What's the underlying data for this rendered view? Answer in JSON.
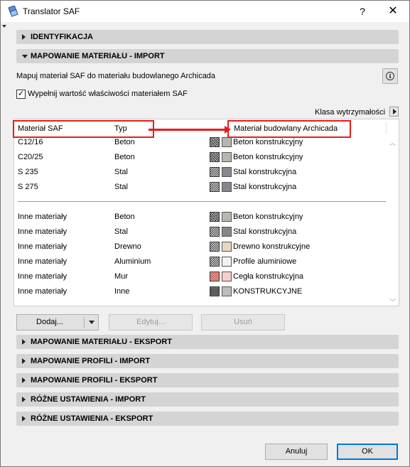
{
  "window": {
    "title": "Translator SAF",
    "help": "?",
    "close": "✕"
  },
  "sections": {
    "identyfikacja": "IDENTYFIKACJA",
    "mapowanie_import": "MAPOWANIE MATERIAŁU - IMPORT",
    "mapowanie_eksport": "MAPOWANIE MATERIAŁU - EKSPORT",
    "profile_import": "MAPOWANIE PROFILI - IMPORT",
    "profile_eksport": "MAPOWANIE PROFILI - EKSPORT",
    "rozne_import": "RÓŻNE USTAWIENIA - IMPORT",
    "rozne_eksport": "RÓŻNE USTAWIENIA - EKSPORT"
  },
  "import_panel": {
    "description": "Mapuj materiał SAF do materiału budowlanego Archicada",
    "info_icon": "i",
    "checkbox_label": "Wypełnij wartość właściwości materiałem SAF",
    "checkbox_checked": true,
    "checkbox_mark": "✓",
    "klasa_label": "Klasa wytrzymałości"
  },
  "table": {
    "headers": {
      "saf": "Materiał SAF",
      "typ": "Typ",
      "archicad": "Materiał budowlany Archicada"
    },
    "rows": [
      {
        "saf": "C12/16",
        "typ": "Beton",
        "archicad": "Beton konstrukcyjny",
        "hatch": "cross",
        "color": "#b7b7b2"
      },
      {
        "saf": "C20/25",
        "typ": "Beton",
        "archicad": "Beton konstrukcyjny",
        "hatch": "cross",
        "color": "#b7b7b2"
      },
      {
        "saf": "S 235",
        "typ": "Stal",
        "archicad": "Stal konstrukcyjna",
        "hatch": "diag",
        "color": "#84878b"
      },
      {
        "saf": "S 275",
        "typ": "Stal",
        "archicad": "Stal konstrukcyjna",
        "hatch": "diag",
        "color": "#84878b"
      }
    ],
    "other_rows": [
      {
        "saf": "Inne materiały",
        "typ": "Beton",
        "archicad": "Beton konstrukcyjny",
        "hatch": "cross",
        "color": "#b7b7b2"
      },
      {
        "saf": "Inne materiały",
        "typ": "Stal",
        "archicad": "Stal konstrukcyjna",
        "hatch": "diag",
        "color": "#84878b"
      },
      {
        "saf": "Inne materiały",
        "typ": "Drewno",
        "archicad": "Drewno konstrukcyjne",
        "hatch": "diag",
        "color": "#e9d7bf"
      },
      {
        "saf": "Inne materiały",
        "typ": "Aluminium",
        "archicad": "Profile aluminiowe",
        "hatch": "diag",
        "color": "#f2f2f2"
      },
      {
        "saf": "Inne materiały",
        "typ": "Mur",
        "archicad": "Cegła konstrukcyjna",
        "hatch": "brick",
        "color": "#f4cfc6"
      },
      {
        "saf": "Inne materiały",
        "typ": "Inne",
        "archicad": "KONSTRUKCYJNE",
        "hatch": "dense",
        "color": "#bdbdbd"
      }
    ]
  },
  "buttons": {
    "add": "Dodaj...",
    "edit": "Edytuj...",
    "delete": "Usuń",
    "cancel": "Anuluj",
    "ok": "OK"
  },
  "colors": {
    "highlight": "#e51c1c",
    "section_bg": "#d4d4d4",
    "ok_border": "#0078d7"
  }
}
